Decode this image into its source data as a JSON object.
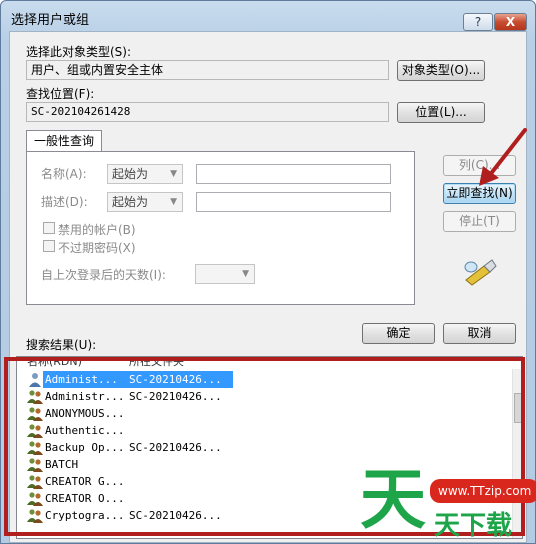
{
  "window": {
    "title": "选择用户或组",
    "help_label": "?",
    "close_label": "X"
  },
  "object_types": {
    "label": "选择此对象类型(S):",
    "value": "用户、组或内置安全主体",
    "button": "对象类型(O)..."
  },
  "location": {
    "label": "查找位置(F):",
    "value": "SC-202104261428",
    "button": "位置(L)..."
  },
  "tab": {
    "label": "一般性查询"
  },
  "query": {
    "name_label": "名称(A):",
    "name_mode": "起始为",
    "desc_label": "描述(D):",
    "desc_mode": "起始为",
    "disabled_accounts": "禁用的帐户(B)",
    "non_expiring_pw": "不过期密码(X)",
    "days_since_logon": "自上次登录后的天数(I):"
  },
  "side_buttons": {
    "columns": "列(C)...",
    "find_now": "立即查找(N)",
    "stop": "停止(T)"
  },
  "actions": {
    "ok": "确定",
    "cancel": "取消"
  },
  "results": {
    "label": "搜索结果(U):",
    "columns": [
      "名称(RDN)",
      "所在文件夹"
    ],
    "rows": [
      {
        "name": "Administ...",
        "folder": "SC-20210426...",
        "icon": "user-icon",
        "selected": true
      },
      {
        "name": "Administr...",
        "folder": "SC-20210426...",
        "icon": "group-icon",
        "selected": false
      },
      {
        "name": "ANONYMOUS...",
        "folder": "",
        "icon": "group-icon",
        "selected": false
      },
      {
        "name": "Authentic...",
        "folder": "",
        "icon": "group-icon",
        "selected": false
      },
      {
        "name": "Backup Op...",
        "folder": "SC-20210426...",
        "icon": "group-icon",
        "selected": false
      },
      {
        "name": "BATCH",
        "folder": "",
        "icon": "group-icon",
        "selected": false
      },
      {
        "name": "CREATOR G...",
        "folder": "",
        "icon": "group-icon",
        "selected": false
      },
      {
        "name": "CREATOR O...",
        "folder": "",
        "icon": "group-icon",
        "selected": false
      },
      {
        "name": "Cryptogra...",
        "folder": "SC-20210426...",
        "icon": "group-icon",
        "selected": false
      }
    ]
  },
  "watermark": {
    "url": "www.TTzip.com",
    "big": "天",
    "text": "天下载"
  },
  "colors": {
    "annotation_red": "#b01e1e",
    "selection_blue": "#3399ff",
    "watermark_green": "#1ea54a"
  }
}
